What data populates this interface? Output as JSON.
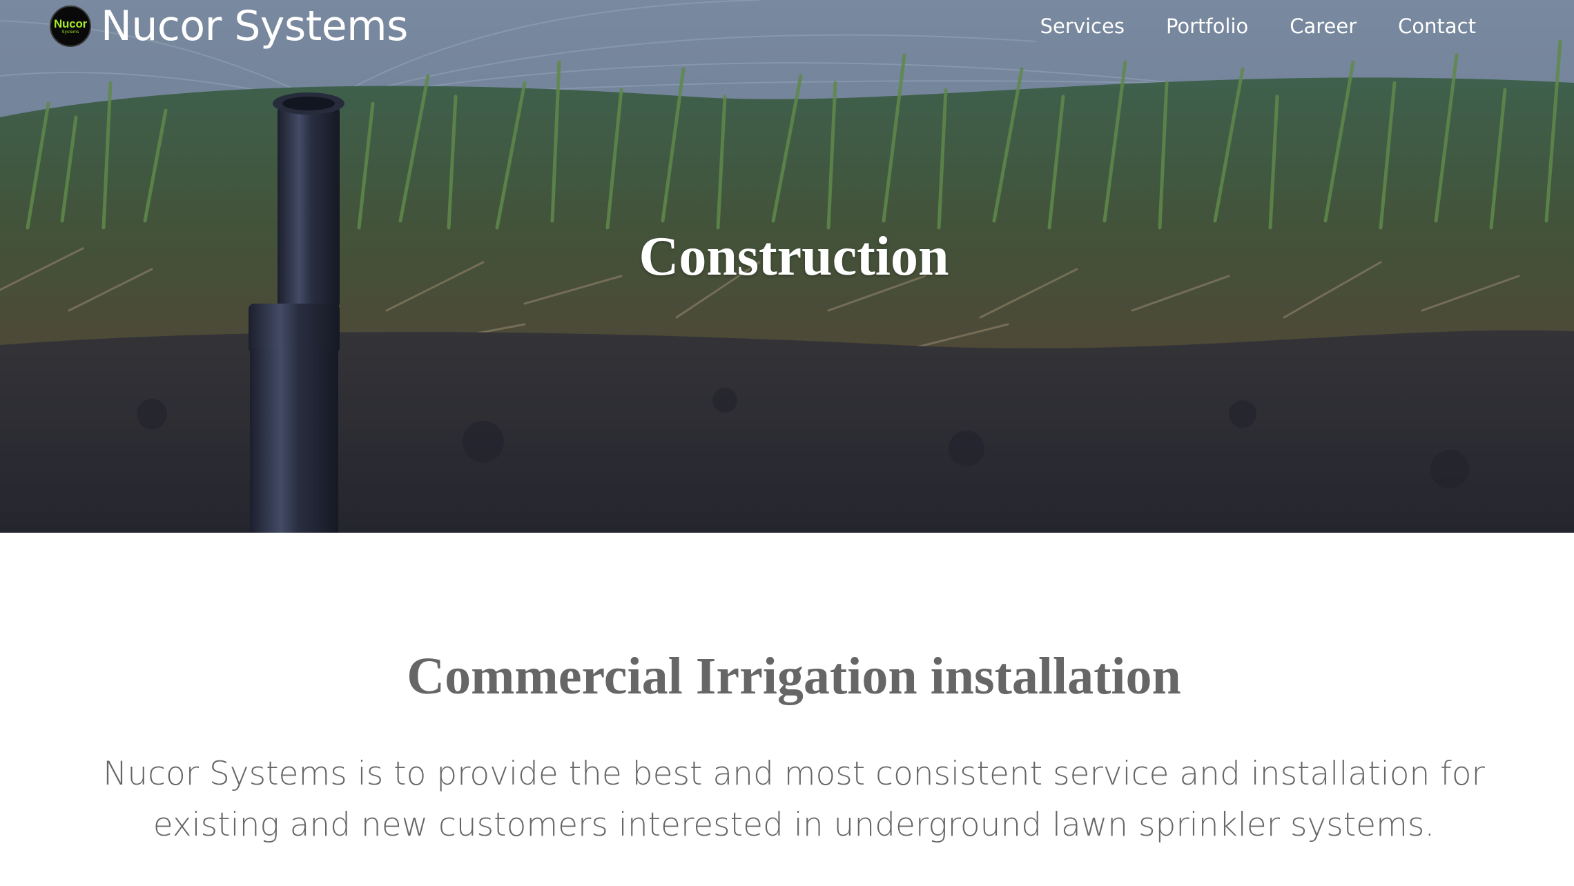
{
  "brand": {
    "logo_text": "Nucor",
    "logo_subtext": "Systems",
    "name": "Nucor Systems"
  },
  "nav": {
    "items": [
      {
        "label": "Services"
      },
      {
        "label": "Portfolio"
      },
      {
        "label": "Career"
      },
      {
        "label": "Contact"
      }
    ]
  },
  "hero": {
    "title": "Construction"
  },
  "content": {
    "title": "Commercial Irrigation installation",
    "description": "Nucor Systems is to provide the best and most consistent service and installation for existing and new customers interested in underground lawn sprinkler systems."
  },
  "colors": {
    "logo_accent": "#a7ea2b",
    "text_white": "#ffffff",
    "text_gray": "#666666"
  }
}
